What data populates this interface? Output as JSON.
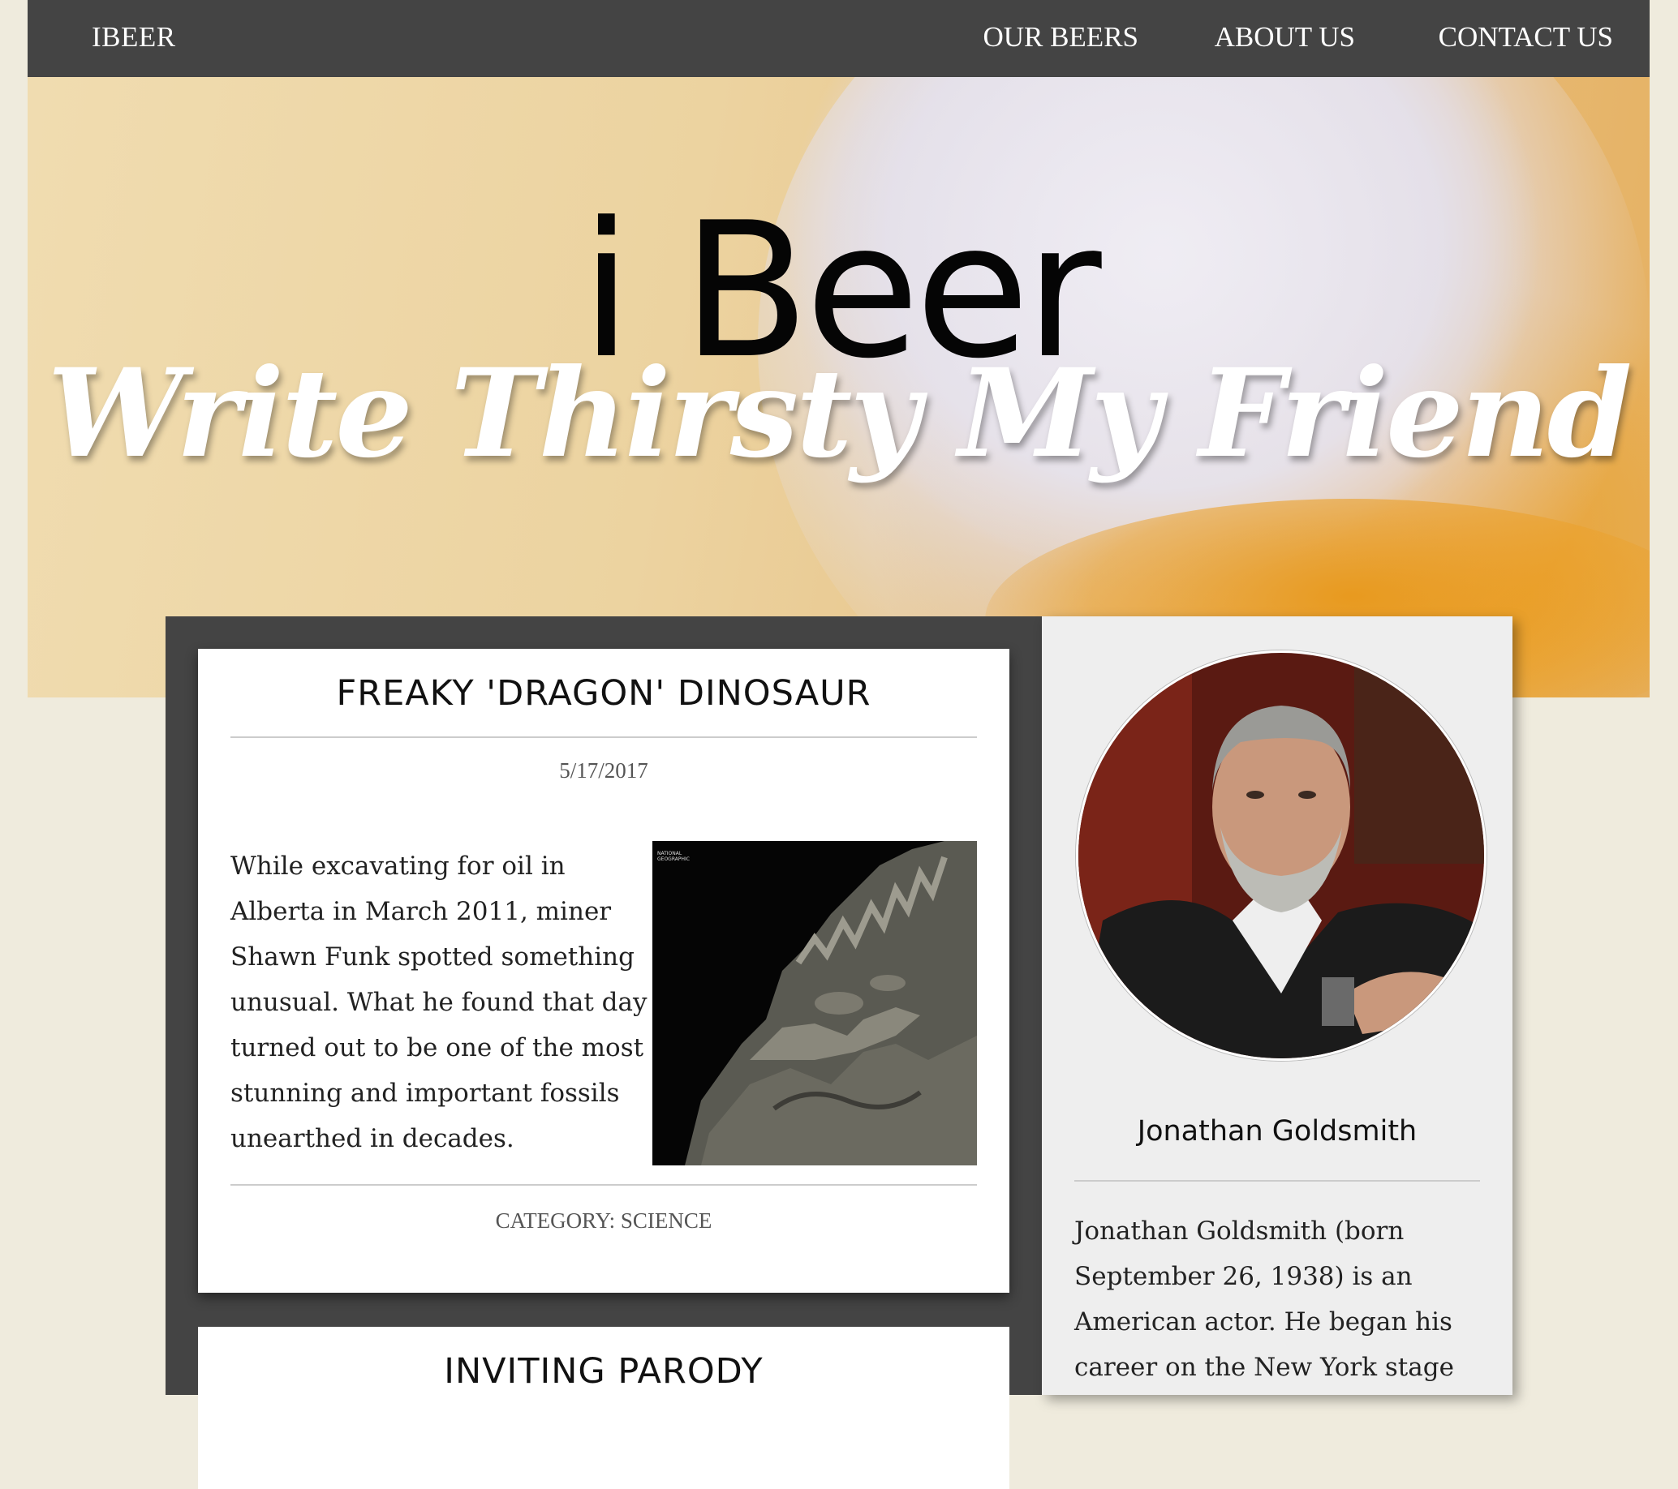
{
  "nav": {
    "brand": "IBEER",
    "links": [
      {
        "label": "OUR BEERS"
      },
      {
        "label": "ABOUT US"
      },
      {
        "label": "CONTACT US"
      }
    ]
  },
  "hero": {
    "title": "i Beer",
    "subtitle": "Write Thirsty My Friend"
  },
  "posts": [
    {
      "title": "FREAKY 'DRAGON' DINOSAUR",
      "date": "5/17/2017",
      "body": "While excavating for oil in Alberta in March 2011, miner Shawn Funk spotted something unusual. What he found that day turned out to be one of the most stunning and important fossils unearthed in decades.",
      "image_caption_mark": "NATIONAL GEOGRAPHIC",
      "category": "CATEGORY: SCIENCE"
    },
    {
      "title": "INVITING PARODY"
    }
  ],
  "profile": {
    "name": "Jonathan Goldsmith",
    "bio": "Jonathan Goldsmith (born September 26, 1938) is an American actor. He began his career on the New York stage"
  }
}
